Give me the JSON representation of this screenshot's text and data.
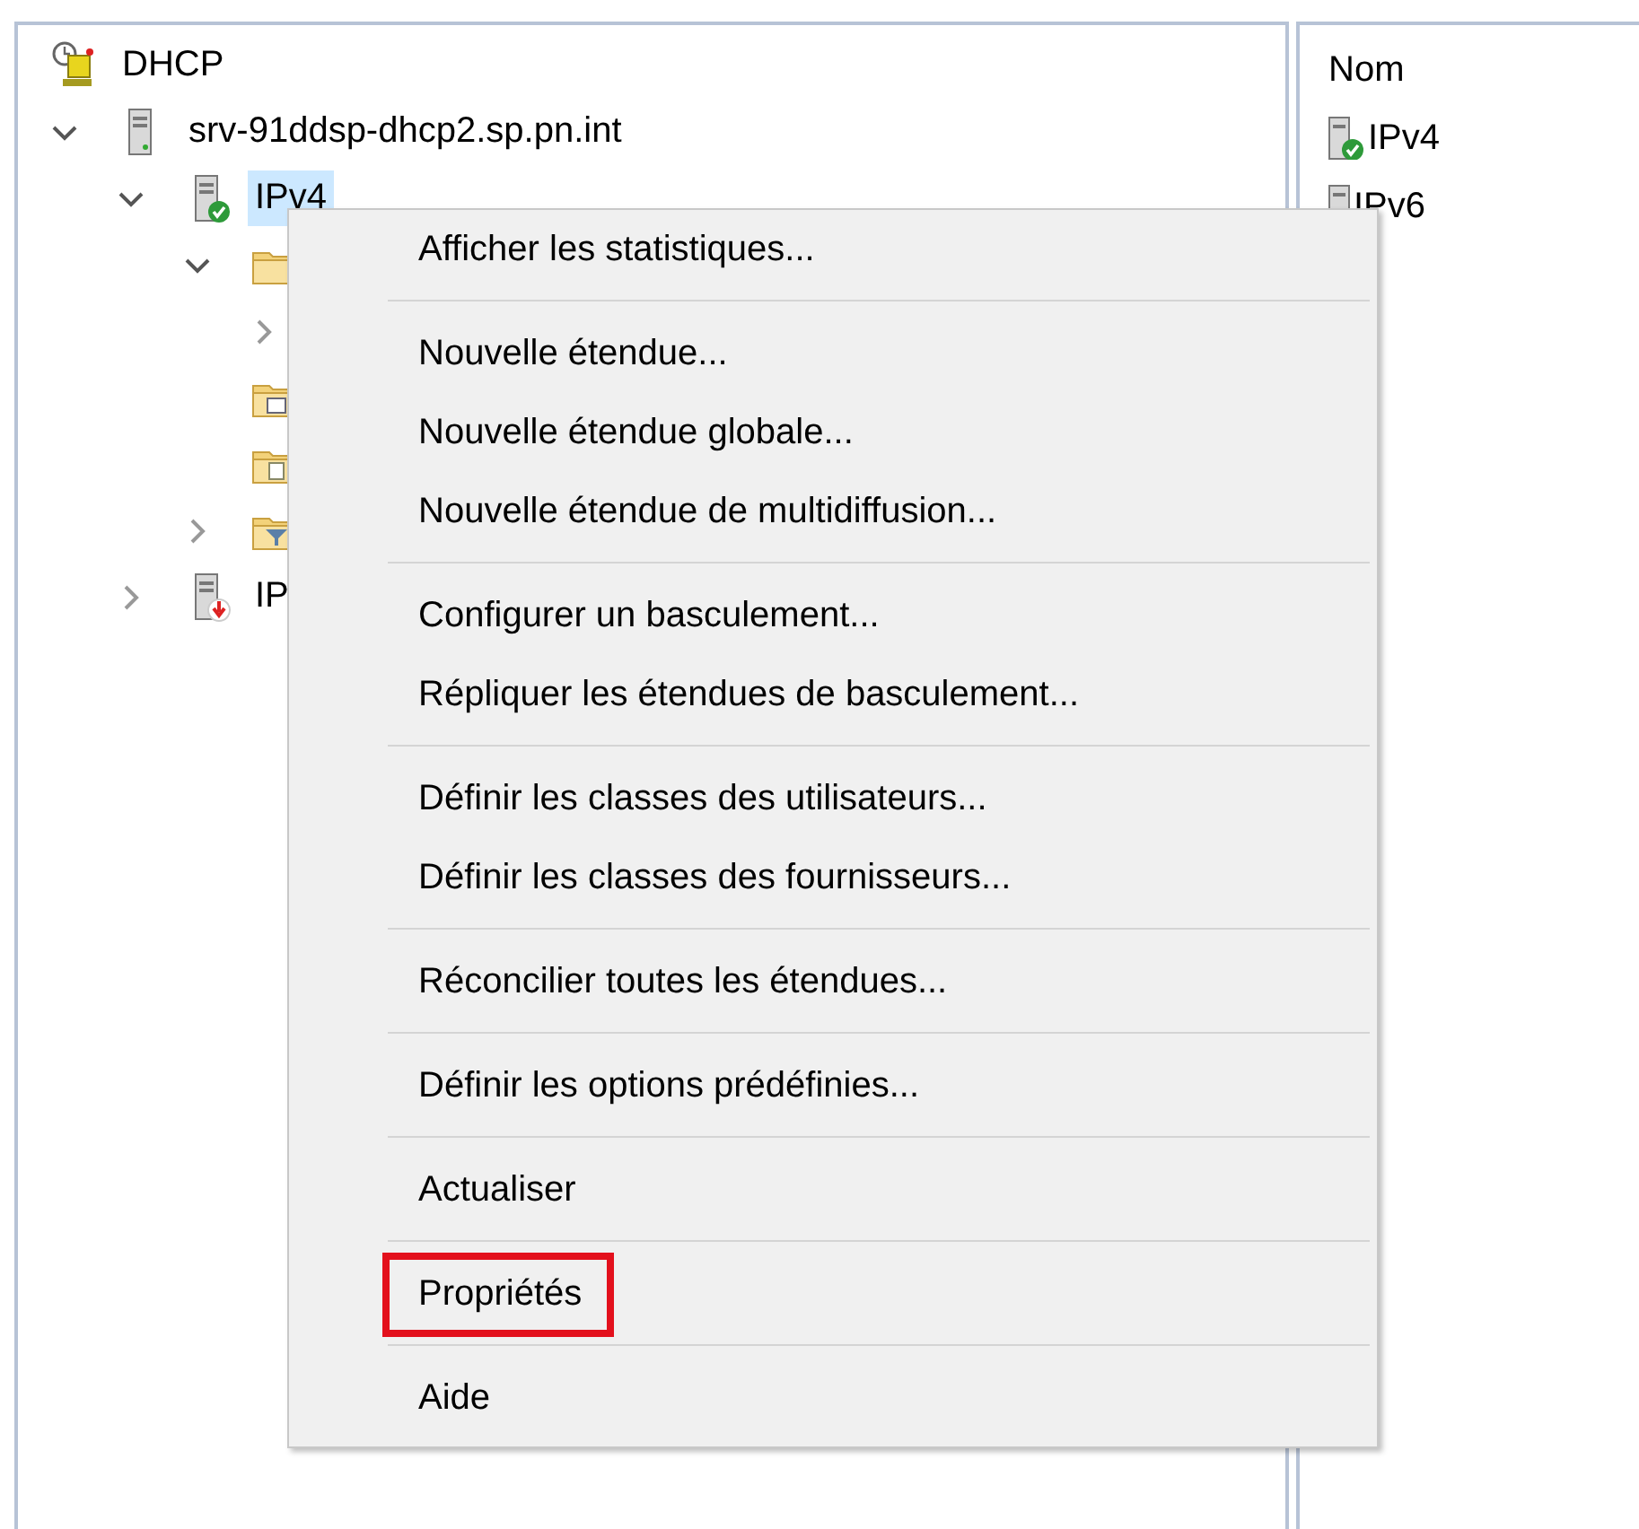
{
  "tree": [
    {
      "label": "DHCP",
      "kind": "dhcp",
      "selected": false,
      "children": [
        {
          "label": "srv-91ddsp-dhcp2.sp.pn.int",
          "kind": "server",
          "expanded": true,
          "selected": false,
          "children": [
            {
              "label": "IPv4",
              "kind": "server-ok",
              "expanded": true,
              "selected": true,
              "children": [
                {
                  "kind": "folder",
                  "expanded": true,
                  "children": [
                    {
                      "expanded": false
                    }
                  ]
                },
                {
                  "kind": "folder-stats"
                },
                {
                  "kind": "folder-policy"
                },
                {
                  "kind": "folder-filter",
                  "expanded": false
                }
              ]
            },
            {
              "label": "IP",
              "kind": "server-down",
              "expanded": false,
              "selected": false
            }
          ]
        }
      ]
    }
  ],
  "list": {
    "column": "Nom",
    "items": [
      {
        "label": "IPv4",
        "kind": "server-ok"
      },
      {
        "label": "IPv6",
        "kind": "server"
      }
    ]
  },
  "context_menu": {
    "groups": [
      [
        {
          "label": "Afficher les statistiques...",
          "highlighted": false
        }
      ],
      [
        {
          "label": "Nouvelle étendue...",
          "highlighted": false
        },
        {
          "label": "Nouvelle étendue globale...",
          "highlighted": false
        },
        {
          "label": "Nouvelle étendue de multidiffusion...",
          "highlighted": false
        }
      ],
      [
        {
          "label": "Configurer un basculement...",
          "highlighted": false
        },
        {
          "label": "Répliquer les étendues de basculement...",
          "highlighted": false
        }
      ],
      [
        {
          "label": "Définir les classes des utilisateurs...",
          "highlighted": false
        },
        {
          "label": "Définir les classes des fournisseurs...",
          "highlighted": false
        }
      ],
      [
        {
          "label": "Réconcilier toutes les étendues...",
          "highlighted": false
        }
      ],
      [
        {
          "label": "Définir les options prédéfinies...",
          "highlighted": false
        }
      ],
      [
        {
          "label": "Actualiser",
          "highlighted": false
        }
      ],
      [
        {
          "label": "Propriétés",
          "highlighted": true
        }
      ],
      [
        {
          "label": "Aide",
          "highlighted": false
        }
      ]
    ]
  }
}
